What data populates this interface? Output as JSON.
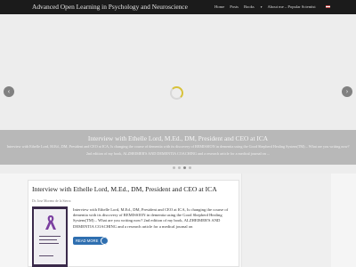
{
  "site": {
    "title": "Advanced Open Learning in Psychology and Neuroscience"
  },
  "menu": {
    "items": [
      "Home",
      "Posts",
      "Books",
      "About me – Popular Scientist"
    ],
    "dropdown_caret": "▾"
  },
  "slider": {
    "arrow_left": "‹",
    "arrow_right": "›",
    "caption_title": "Interview with Ethelle Lord, M.Ed., DM, President and CEO at ICA",
    "caption_text": "Interview with Ethelle Lord, M.Ed., DM, President and CEO at ICA, Is changing the course of dementia with its discovery of REMISSION in dementia using the Good Shepherd Healing System(TM) – What are you writing now? 2nd edition of my book, ALZHEIMER'S AND DEMENTIA COACHING and a research article for a medical journal on ...",
    "dot_count": 4,
    "active_dot": 2
  },
  "post": {
    "title": "Interview with Ethelle Lord, M.Ed., DM, President and CEO at ICA",
    "author": "Dr. Jose Moreno de la Sierra",
    "excerpt": "Interview with Ethelle Lord, M.Ed., DM, President and CEO at ICA, Is changing the course of dementia with its discovery of REMISSION in dementia using the Good Shepherd Healing System(TM) – What are you writing now? 2nd edition of my book, ALZHEIMER'S AND DEMENTIA COACHING and a research article for a medical journal on",
    "read_more": "READ MORE"
  },
  "colors": {
    "topbar": "#1b1b1b",
    "accent": "#2f6fb0",
    "ribbon": "#7b3fa0"
  }
}
